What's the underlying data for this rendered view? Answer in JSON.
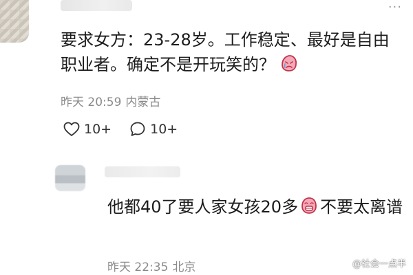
{
  "comment": {
    "text": "要求女方：23-28岁。工作稳定、最好是自由职业者。确定不是开玩笑的？",
    "emoji_icon": "crying-face-icon",
    "time": "昨天 20:59",
    "location": "内蒙古",
    "likes": "10+",
    "replies": "10+",
    "more_label": "···"
  },
  "reply": {
    "text_before": "他都40了要人家女孩20多",
    "emoji_icon": "sweating-face-icon",
    "text_after": "不要太离谱",
    "time": "昨天 22:35",
    "location": "北京"
  },
  "watermark": {
    "text": "@社会一点半"
  },
  "colors": {
    "text": "#1c1c1c",
    "meta": "#8a8a8a",
    "emoji_fill": "#f4a9b8",
    "emoji_stroke": "#c0344a"
  }
}
